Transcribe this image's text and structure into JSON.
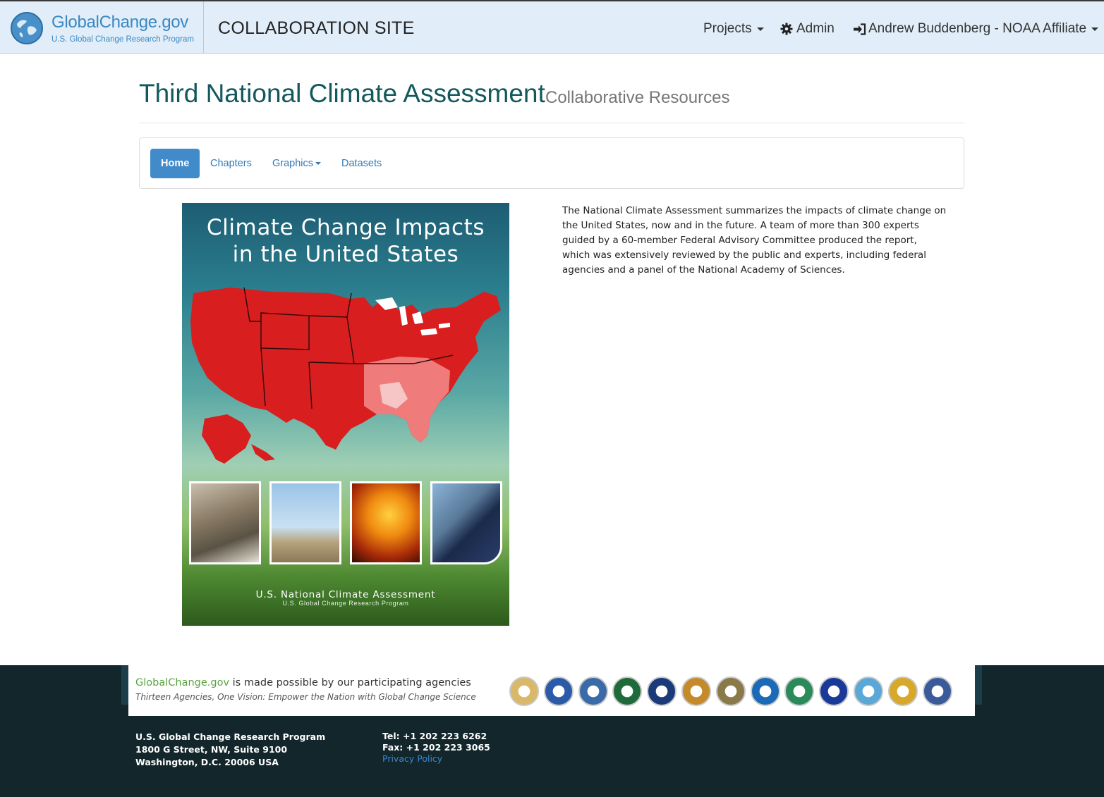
{
  "topbar": {
    "brand_name": "GlobalChange.gov",
    "brand_subtitle": "U.S. Global Change Research Program",
    "site_title": "COLLABORATION SITE",
    "projects_label": "Projects",
    "admin_label": "Admin",
    "user_label": "Andrew Buddenberg - NOAA Affiliate",
    "icons": [
      "globe-logo-icon",
      "gear-icon",
      "sign-in-icon",
      "chevron-down-icon"
    ]
  },
  "page": {
    "title": "Third National Climate Assessment",
    "subtitle": "Collaborative Resources"
  },
  "tabs": [
    {
      "label": "Home",
      "active": true
    },
    {
      "label": "Chapters",
      "active": false
    },
    {
      "label": "Graphics",
      "active": false,
      "dropdown": true
    },
    {
      "label": "Datasets",
      "active": false
    }
  ],
  "cover": {
    "title_line1": "Climate Change Impacts",
    "title_line2": "in the United States",
    "footer_line1": "U.S. National Climate Assessment",
    "footer_line2": "U.S. Global Change Research Program"
  },
  "intro_text": "The National Climate Assessment summarizes the impacts of climate change on the United States, now and in the future. A team of more than 300 experts guided by a 60-member Federal Advisory Committee produced the report, which was extensively reviewed by the public and experts, including federal agencies and a panel of the National Academy of Sciences.",
  "footer": {
    "agency_brand": "GlobalChange.gov",
    "agency_line_rest": " is made possible by our participating agencies",
    "agency_tagline": "Thirteen Agencies, One Vision: Empower the Nation with Global Change Science",
    "org_name": "U.S. Global Change Research Program",
    "address1": "1800 G Street, NW, Suite 9100",
    "address2": "Washington, D.C. 20006 USA",
    "tel": "Tel: +1 202 223 6262",
    "fax": "Fax: +1 202 223 3065",
    "privacy_link": "Privacy Policy",
    "seal_colors": [
      "#d9b86a",
      "#2a5aa8",
      "#3a6aa8",
      "#1f6a3a",
      "#1a3a7a",
      "#c58a2a",
      "#8a7a4a",
      "#1a6ab8",
      "#2a8a5a",
      "#1a3a9a",
      "#5aa8d8",
      "#d8a82a",
      "#3a5a9a"
    ]
  },
  "colors": {
    "topbar_bg": "#e1eef9",
    "brand_blue": "#3a87c2",
    "title_teal": "#12585d",
    "tab_active": "#428bca",
    "link": "#337ab7",
    "footer_bg": "#12262b",
    "gc_green": "#5aa33f"
  }
}
